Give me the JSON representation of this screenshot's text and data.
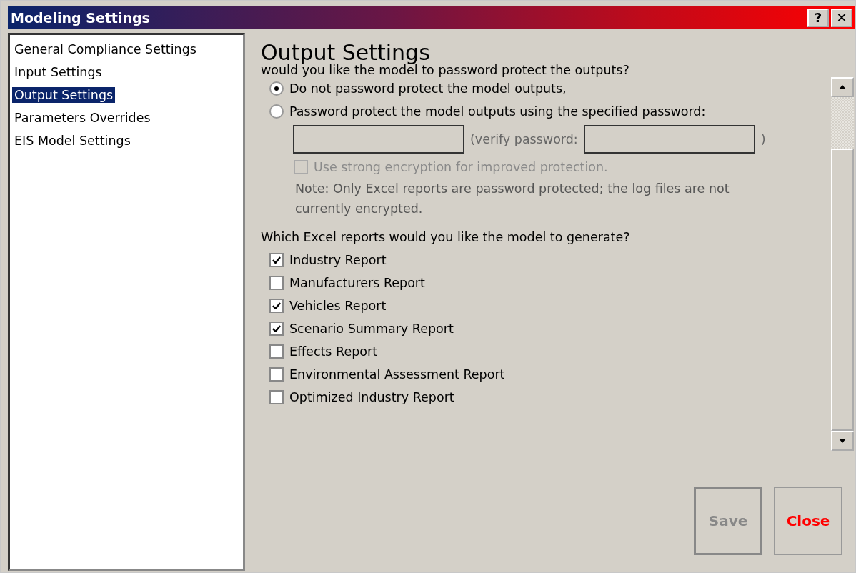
{
  "window": {
    "title": "Modeling Settings",
    "buttons": [
      "?",
      "✕"
    ]
  },
  "sidebar": {
    "items": [
      {
        "label": "General Compliance Settings",
        "selected": false
      },
      {
        "label": "Input Settings",
        "selected": false
      },
      {
        "label": "Output Settings",
        "selected": true
      },
      {
        "label": "Parameters Overrides",
        "selected": false
      },
      {
        "label": "EIS Model Settings",
        "selected": false
      }
    ]
  },
  "content": {
    "heading": "Output Settings",
    "password_question": "would you like the model to password protect the outputs?",
    "password_options": [
      {
        "label": "Do not password protect the model outputs,",
        "selected": true
      },
      {
        "label": "Password protect the model outputs using the specified password:",
        "selected": false
      }
    ],
    "password_fields": {
      "disabled": true,
      "verify_label": "(verify password:",
      "close_paren": ")"
    },
    "strong_encryption": {
      "label": "Use strong encryption for improved protection.",
      "checked": false,
      "disabled": true
    },
    "note": "Note:  Only Excel reports are password protected; the log files are not currently encrypted.",
    "reports_question": "Which Excel reports would you like the model to generate?",
    "reports": [
      {
        "label": "Industry Report",
        "checked": true
      },
      {
        "label": "Manufacturers Report",
        "checked": false
      },
      {
        "label": "Vehicles Report",
        "checked": true
      },
      {
        "label": "Scenario Summary Report",
        "checked": true
      },
      {
        "label": "Effects Report",
        "checked": false
      },
      {
        "label": "Environmental Assessment Report",
        "checked": false
      },
      {
        "label": "Optimized Industry Report",
        "checked": false
      }
    ]
  },
  "buttons": [
    {
      "label": "Save",
      "kind": "save",
      "disabled": true
    },
    {
      "label": "Close",
      "kind": "close",
      "disabled": false
    }
  ]
}
